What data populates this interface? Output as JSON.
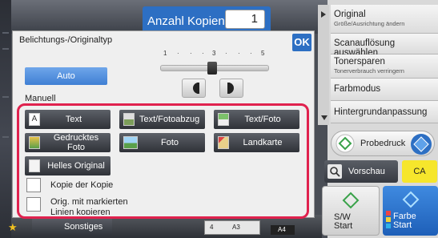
{
  "header": {
    "copies_label": "Anzahl Kopien",
    "copies_value": "1"
  },
  "dialog": {
    "title": "Belichtungs-/Originaltyp",
    "ok_label": "OK",
    "auto_label": "Auto",
    "manual_label": "Manuell",
    "exposure_scale": [
      "1",
      "·",
      "·",
      "·",
      "3",
      "·",
      "·",
      "·",
      "5"
    ],
    "exposure_level": 3,
    "type_buttons": [
      {
        "label": "Text",
        "icon": "text-icon"
      },
      {
        "label": "Text/Fotoabzug",
        "icon": "text-photoprint-icon"
      },
      {
        "label": "Text/Foto",
        "icon": "text-photo-icon"
      },
      {
        "label": "Gedrucktes Foto",
        "icon": "printed-photo-icon"
      },
      {
        "label": "Foto",
        "icon": "photo-icon"
      },
      {
        "label": "Landkarte",
        "icon": "map-icon"
      },
      {
        "label": "Helles Original",
        "icon": "light-original-icon"
      }
    ],
    "checkboxes": [
      {
        "label": "Kopie der Kopie",
        "checked": false
      },
      {
        "label_line1": "Orig. mit markierten",
        "label_line2": "Linien kopieren",
        "checked": false
      }
    ],
    "highlight_color": "#e0224e"
  },
  "sidebar": {
    "items": [
      {
        "label": "Original",
        "sub": "Größe/Ausrichtung ändern"
      },
      {
        "label": "Scanauflösung auswählen",
        "sub": ""
      },
      {
        "label": "Tonersparen",
        "sub": "Tonerverbrauch verringern"
      },
      {
        "label": "Farbmodus",
        "sub": ""
      },
      {
        "label": "Hintergrundanpassung",
        "sub": ""
      }
    ],
    "probedruck_label": "Probedruck",
    "vorschau_label": "Vorschau",
    "ca_label": "CA",
    "sw_start_line1": "S/W",
    "sw_start_line2": "Start",
    "farbe_start_line1": "Farbe",
    "farbe_start_line2": "Start"
  },
  "bottom": {
    "sonstiges_label": "Sonstiges",
    "tray_a": "4",
    "tray_b": "A3",
    "tray_c": "A4"
  },
  "colors": {
    "accent_blue": "#2d6fc3",
    "ca_yellow": "#f6e62c",
    "highlight_red": "#e0224e"
  }
}
